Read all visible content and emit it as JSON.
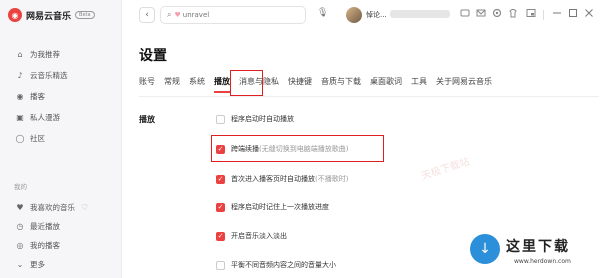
{
  "app": {
    "logo_glyph": "◉",
    "name": "网易云音乐",
    "badge": "Beta"
  },
  "sidebar": {
    "items": [
      {
        "icon": "⌂",
        "label": "为我推荐"
      },
      {
        "icon": "♪",
        "label": "云音乐精选"
      },
      {
        "icon": "◉",
        "label": "播客"
      },
      {
        "icon": "▣",
        "label": "私人漫游"
      },
      {
        "icon": "◯",
        "label": "社区"
      }
    ],
    "mine_title": "我的",
    "mine_items": [
      {
        "icon": "♥",
        "label": "我喜欢的音乐"
      },
      {
        "icon": "◷",
        "label": "最近播放"
      },
      {
        "icon": "◎",
        "label": "我的播客"
      },
      {
        "icon": "⌄",
        "label": "更多"
      }
    ],
    "heart_outline": "♡"
  },
  "topbar": {
    "back": "‹",
    "search_icon": "⌕",
    "search_heart": "♥",
    "search_placeholder": "unravel",
    "mic": "🎙",
    "username": "悼论..."
  },
  "settings": {
    "title": "设置",
    "tabs": [
      "账号",
      "常规",
      "系统",
      "播放",
      "消息与隐私",
      "快捷键",
      "音质与下载",
      "桌面歌词",
      "工具",
      "关于网易云音乐"
    ],
    "active_tab": "播放",
    "section_label": "播放",
    "options": [
      {
        "label": "程序启动时自动播放",
        "note": "",
        "checked": false
      },
      {
        "label": "跨端续播",
        "note": "(无缝切换到电脑端播放歌曲)",
        "checked": true
      },
      {
        "label": "首次进入播客页时自动播放",
        "note": "(不播歌时)",
        "checked": true
      },
      {
        "label": "程序启动时记住上一次播放进度",
        "note": "",
        "checked": true
      },
      {
        "label": "开启音乐淡入淡出",
        "note": "",
        "checked": true
      },
      {
        "label": "平衡不同音频内容之间的音量大小",
        "note": "",
        "checked": false
      }
    ]
  },
  "watermark": "天极下载站",
  "brand": {
    "logo_glyph": "↓",
    "name": "这里下载",
    "url": "www.herdown.com"
  },
  "colors": {
    "accent": "#ec4141",
    "highlight_box": "#e02020",
    "sidebar_bg": "#f6f6f8"
  }
}
